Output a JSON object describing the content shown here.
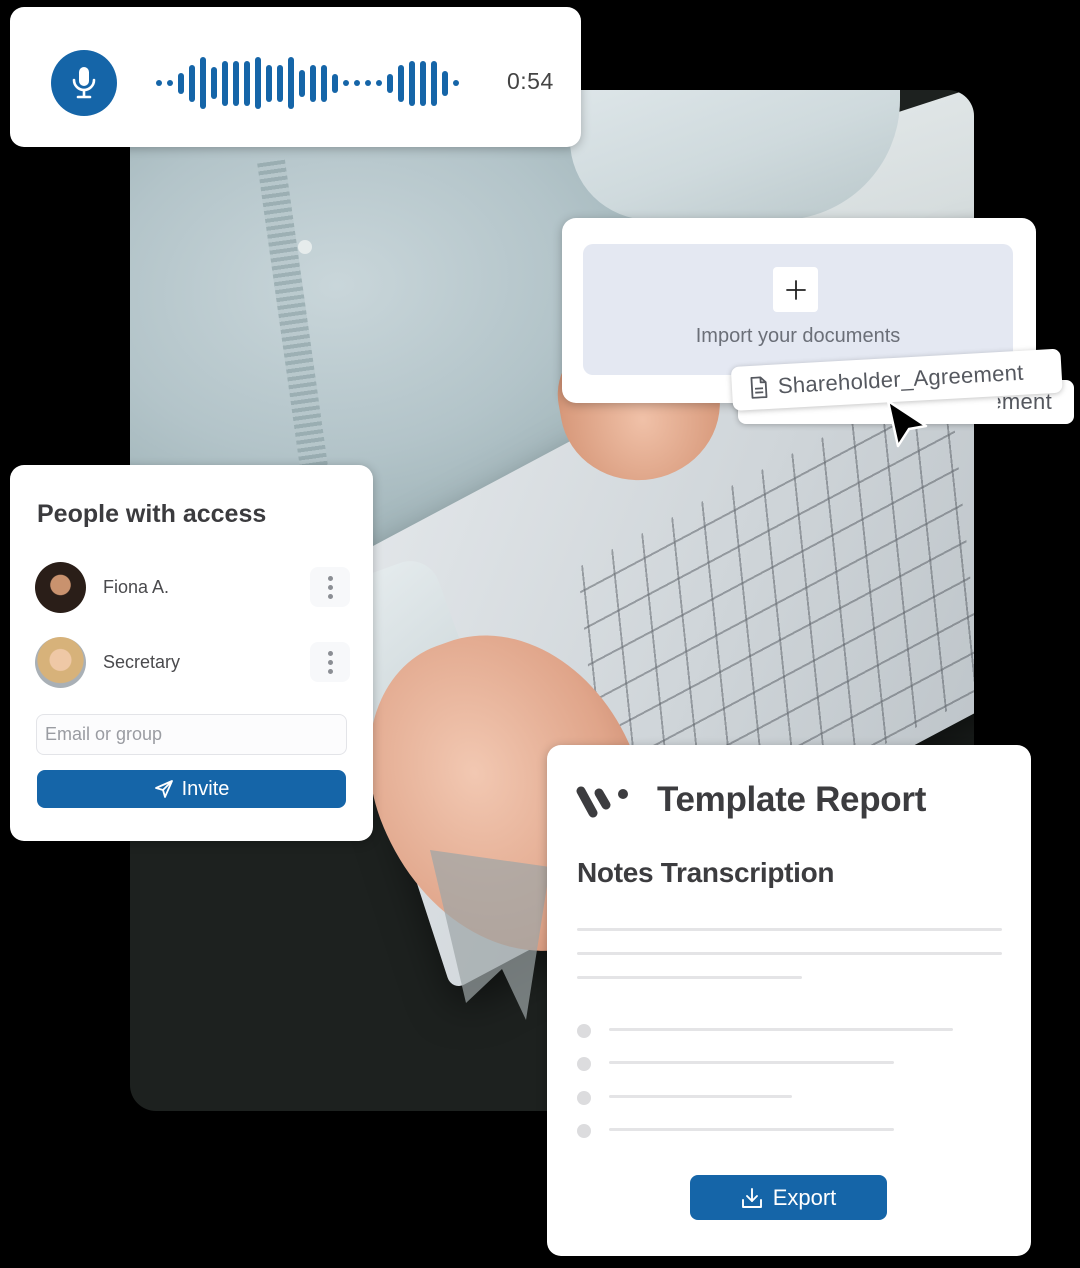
{
  "colors": {
    "accent": "#1565a8",
    "background": "#000000",
    "card": "#ffffff",
    "dropzone": "#e4e8f2",
    "placeholder_line": "#e4e4e6"
  },
  "audio_recorder": {
    "mic_icon": "microphone-icon",
    "duration": "0:54",
    "waveform_levels": [
      0.12,
      0.12,
      0.4,
      0.72,
      1.0,
      0.62,
      0.86,
      0.86,
      0.86,
      1.0,
      0.72,
      0.72,
      1.0,
      0.52,
      0.72,
      0.72,
      0.36,
      0.12,
      0.12,
      0.12,
      0.12,
      0.36,
      0.72,
      0.86,
      0.86,
      0.86,
      0.48,
      0.12
    ]
  },
  "import": {
    "add_icon": "plus-icon",
    "label": "Import your documents",
    "file_icon": "document-icon",
    "dragged_file": "Shareholder_Agreement",
    "stacked_file": "Shareholder_Agreement",
    "cursor_icon": "pointer-cursor-icon"
  },
  "people": {
    "title": "People with access",
    "members": [
      {
        "name": "Fiona A.",
        "menu_icon": "more-vertical-icon"
      },
      {
        "name": "Secretary",
        "menu_icon": "more-vertical-icon"
      }
    ],
    "email_placeholder": "Email or group",
    "invite_label": "Invite",
    "invite_icon": "send-icon"
  },
  "report": {
    "logo": "brand-logo",
    "title": "Template Report",
    "subtitle": "Notes Transcription",
    "paragraph_lines": [
      1.0,
      1.0,
      0.53
    ],
    "bullet_lines": [
      0.81,
      0.67,
      0.43,
      0.67
    ],
    "export_label": "Export",
    "export_icon": "download-icon"
  }
}
